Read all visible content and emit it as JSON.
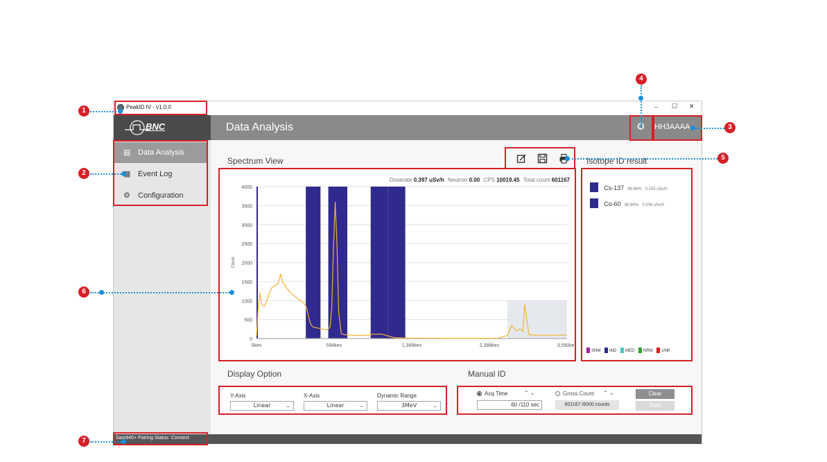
{
  "window": {
    "title": "PeakID IV - v1.0.0",
    "controls": {
      "minimize": "–",
      "maximize": "☐",
      "close": "✕"
    }
  },
  "brand": {
    "logo_text": "BNC"
  },
  "header": {
    "page_title": "Data Analysis",
    "device_id": "HH3AAAA"
  },
  "sidebar": {
    "items": [
      {
        "label": "Data Analysis",
        "icon": "monitor-icon",
        "active": true
      },
      {
        "label": "Event Log",
        "icon": "calendar-icon",
        "active": false
      },
      {
        "label": "Configuration",
        "icon": "gear-icon",
        "active": false
      }
    ]
  },
  "spectrum": {
    "section_title": "Spectrum View",
    "stats": {
      "doserate_label": "Doserate",
      "doserate_value": "0.397 uSv/h",
      "neutron_label": "Neutron",
      "neutron_value": "0.00",
      "cps_label": "CPS",
      "cps_value": "10019.45",
      "total_label": "Total count",
      "total_value": "601167"
    }
  },
  "toolbar": {
    "icons": [
      "edit-icon",
      "save-icon",
      "print-icon"
    ]
  },
  "isotope": {
    "section_title": "Isotope ID result",
    "results": [
      {
        "name": "Cs-137",
        "confidence": "99.96%",
        "dose": "0.150 uSv/h",
        "color": "#2e2a8c"
      },
      {
        "name": "Co-60",
        "confidence": "98.96%",
        "dose": "0.006 uSv/h",
        "color": "#2e2a8c"
      }
    ],
    "legend": [
      {
        "label": "SNM",
        "color": "#a020a0"
      },
      {
        "label": "IND",
        "color": "#2e2a8c"
      },
      {
        "label": "MED",
        "color": "#49c7c0"
      },
      {
        "label": "NRM",
        "color": "#2ea02e"
      },
      {
        "label": "UNK",
        "color": "#e01b1b"
      }
    ]
  },
  "display_option": {
    "section_title": "Display Option",
    "y_axis": {
      "label": "Y-Axis",
      "value": "Linear"
    },
    "x_axis": {
      "label": "X-Axis",
      "value": "Linear"
    },
    "dynamic_range": {
      "label": "Dynamic Range",
      "value": "3MeV"
    }
  },
  "manual_id": {
    "section_title": "Manual ID",
    "acq_time": {
      "label": "Acq Time",
      "value": "60 /110 sec",
      "selected": true
    },
    "gross_count": {
      "label": "Gross Count",
      "value": "601167 /6000 counts",
      "selected": false
    },
    "clear_label": "Clear",
    "start_label": "Start"
  },
  "status": {
    "text": "Sam940+ Pairing Status:  Connect"
  },
  "callouts": [
    "1",
    "2",
    "3",
    "4",
    "5",
    "6",
    "7"
  ],
  "chart_data": {
    "type": "line",
    "ylabel": "Count",
    "ylim": [
      0,
      4000
    ],
    "yticks": [
      "0",
      "500",
      "1000",
      "1500",
      "2000",
      "2500",
      "3000",
      "3500",
      "4000"
    ],
    "xlabels": [
      "0kev",
      "594kev",
      "1,389kev",
      "2,388kev",
      "3,590kev"
    ],
    "xlim_kev": [
      0,
      3590
    ],
    "grid": "horizontal",
    "roi_bands_kev": [
      [
        0,
        15
      ],
      [
        570,
        740
      ],
      [
        830,
        1050
      ],
      [
        1320,
        1520
      ],
      [
        1520,
        1720
      ]
    ],
    "series": [
      {
        "color": "#f2b233",
        "x": [
          0,
          20,
          40,
          60,
          90,
          120,
          150,
          180,
          220,
          250,
          280,
          300,
          330,
          360,
          400,
          450,
          500,
          540,
          560,
          580,
          600,
          620,
          640,
          660,
          700,
          740,
          780,
          820,
          850,
          870,
          890,
          910,
          930,
          950,
          980,
          1020,
          1080,
          1140,
          1200,
          1250,
          1320,
          1350,
          1380,
          1420,
          1460,
          1500,
          1600,
          1800,
          2000,
          2200,
          2400,
          2600,
          2800,
          2900,
          2950,
          3000,
          3050,
          3080,
          3100,
          3150,
          3200,
          3300,
          3400,
          3500,
          3590
        ],
        "y": [
          50,
          800,
          1200,
          900,
          850,
          1000,
          1200,
          1350,
          1400,
          1450,
          1700,
          1500,
          1400,
          1300,
          1200,
          1100,
          1000,
          950,
          900,
          800,
          600,
          420,
          330,
          300,
          280,
          260,
          240,
          230,
          300,
          800,
          2400,
          3600,
          2500,
          700,
          130,
          100,
          90,
          80,
          80,
          80,
          100,
          120,
          110,
          120,
          110,
          80,
          20,
          10,
          10,
          5,
          5,
          5,
          10,
          80,
          350,
          200,
          250,
          180,
          900,
          100,
          90,
          90,
          90,
          90,
          90
        ]
      }
    ]
  }
}
